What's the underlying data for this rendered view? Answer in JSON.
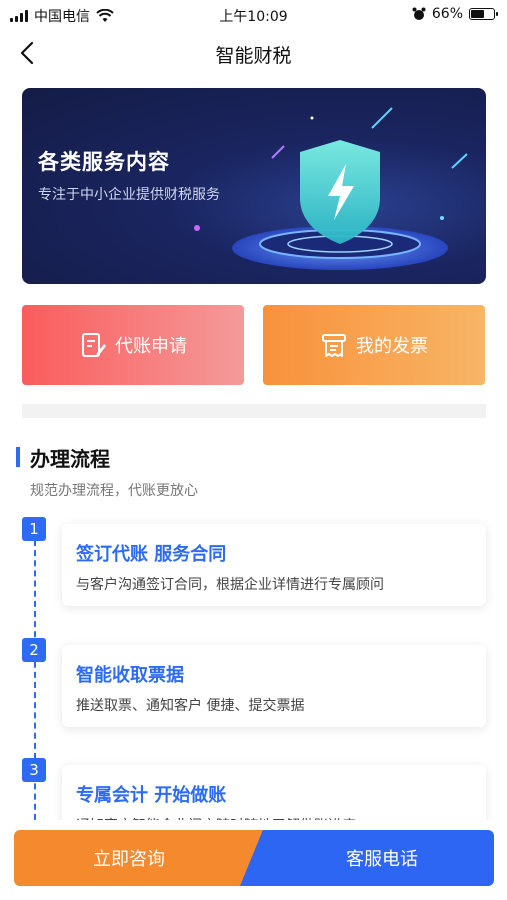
{
  "status_bar": {
    "carrier": "中国电信",
    "time": "上午10:09",
    "battery_percent": "66%",
    "battery_level": 0.66
  },
  "nav": {
    "title": "智能财税",
    "back_icon": "chevron-left-icon"
  },
  "banner": {
    "title": "各类服务内容",
    "subtitle": "专注于中小企业提供财税服务",
    "icon": "shield-lightning-icon"
  },
  "actions": [
    {
      "label": "代账申请",
      "icon": "edit-document-icon",
      "color": "#fb5c5c"
    },
    {
      "label": "我的发票",
      "icon": "receipt-icon",
      "color": "#f8913c"
    }
  ],
  "process": {
    "title": "办理流程",
    "subtitle": "规范办理流程，代账更放心",
    "steps": [
      {
        "num": "1",
        "title": "签订代账 服务合同",
        "desc": "与客户沟通签订合同，根据企业详情进行专属顾问"
      },
      {
        "num": "2",
        "title": "智能收取票据",
        "desc": "推送取票、通知客户 便捷、提交票据"
      },
      {
        "num": "3",
        "title": "专属会计 开始做账",
        "desc": "通知客户智能企业门户随时随地了解做账进度"
      }
    ]
  },
  "bottom_bar": {
    "consult_label": "立即咨询",
    "phone_label": "客服电话"
  },
  "colors": {
    "accent": "#2d6bf4",
    "orange": "#f5892d",
    "red": "#fb5c5c"
  }
}
